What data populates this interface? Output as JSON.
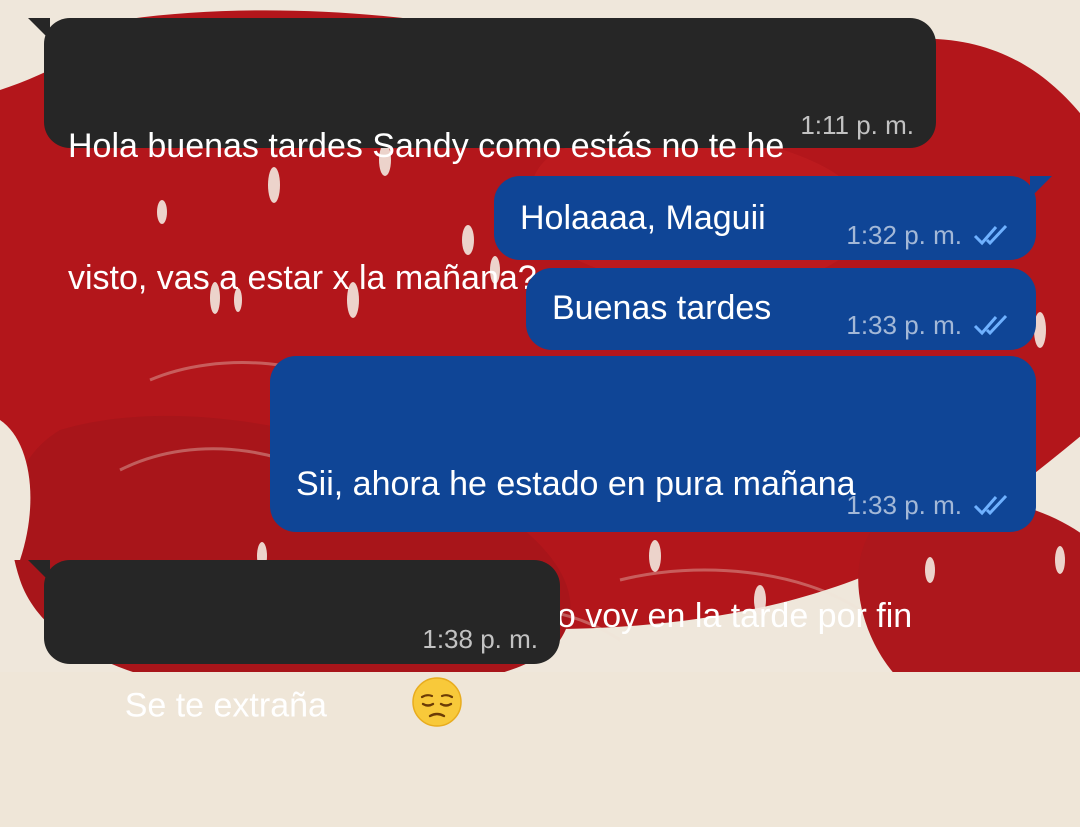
{
  "theme": {
    "incoming_bubble": "#262626",
    "outgoing_bubble": "#0f4596",
    "read_check_color": "#6fb1ff",
    "wallpaper_red": "#b3161b",
    "wallpaper_cream": "#efe7db"
  },
  "messages": [
    {
      "direction": "incoming",
      "line1": "Hola buenas tardes Sandy como estás no te he",
      "line2": "visto, vas a estar x la mañana?",
      "time": "1:11 p. m."
    },
    {
      "direction": "outgoing",
      "text": "Holaaaa, Maguii",
      "time": "1:32 p. m.",
      "status": "read-double-check-icon"
    },
    {
      "direction": "outgoing",
      "text": "Buenas tardes",
      "time": "1:33 p. m.",
      "status": "read-double-check-icon"
    },
    {
      "direction": "outgoing",
      "line1": "Sii, ahora he estado en pura mañana",
      "line2": "Pero ya el Sabado voy en la tarde por fin",
      "time": "1:33 p. m.",
      "status": "read-double-check-icon"
    },
    {
      "direction": "incoming",
      "text": "Se te extraña",
      "emoji": "pensive-face-emoji-icon",
      "time": "1:38 p. m."
    }
  ]
}
